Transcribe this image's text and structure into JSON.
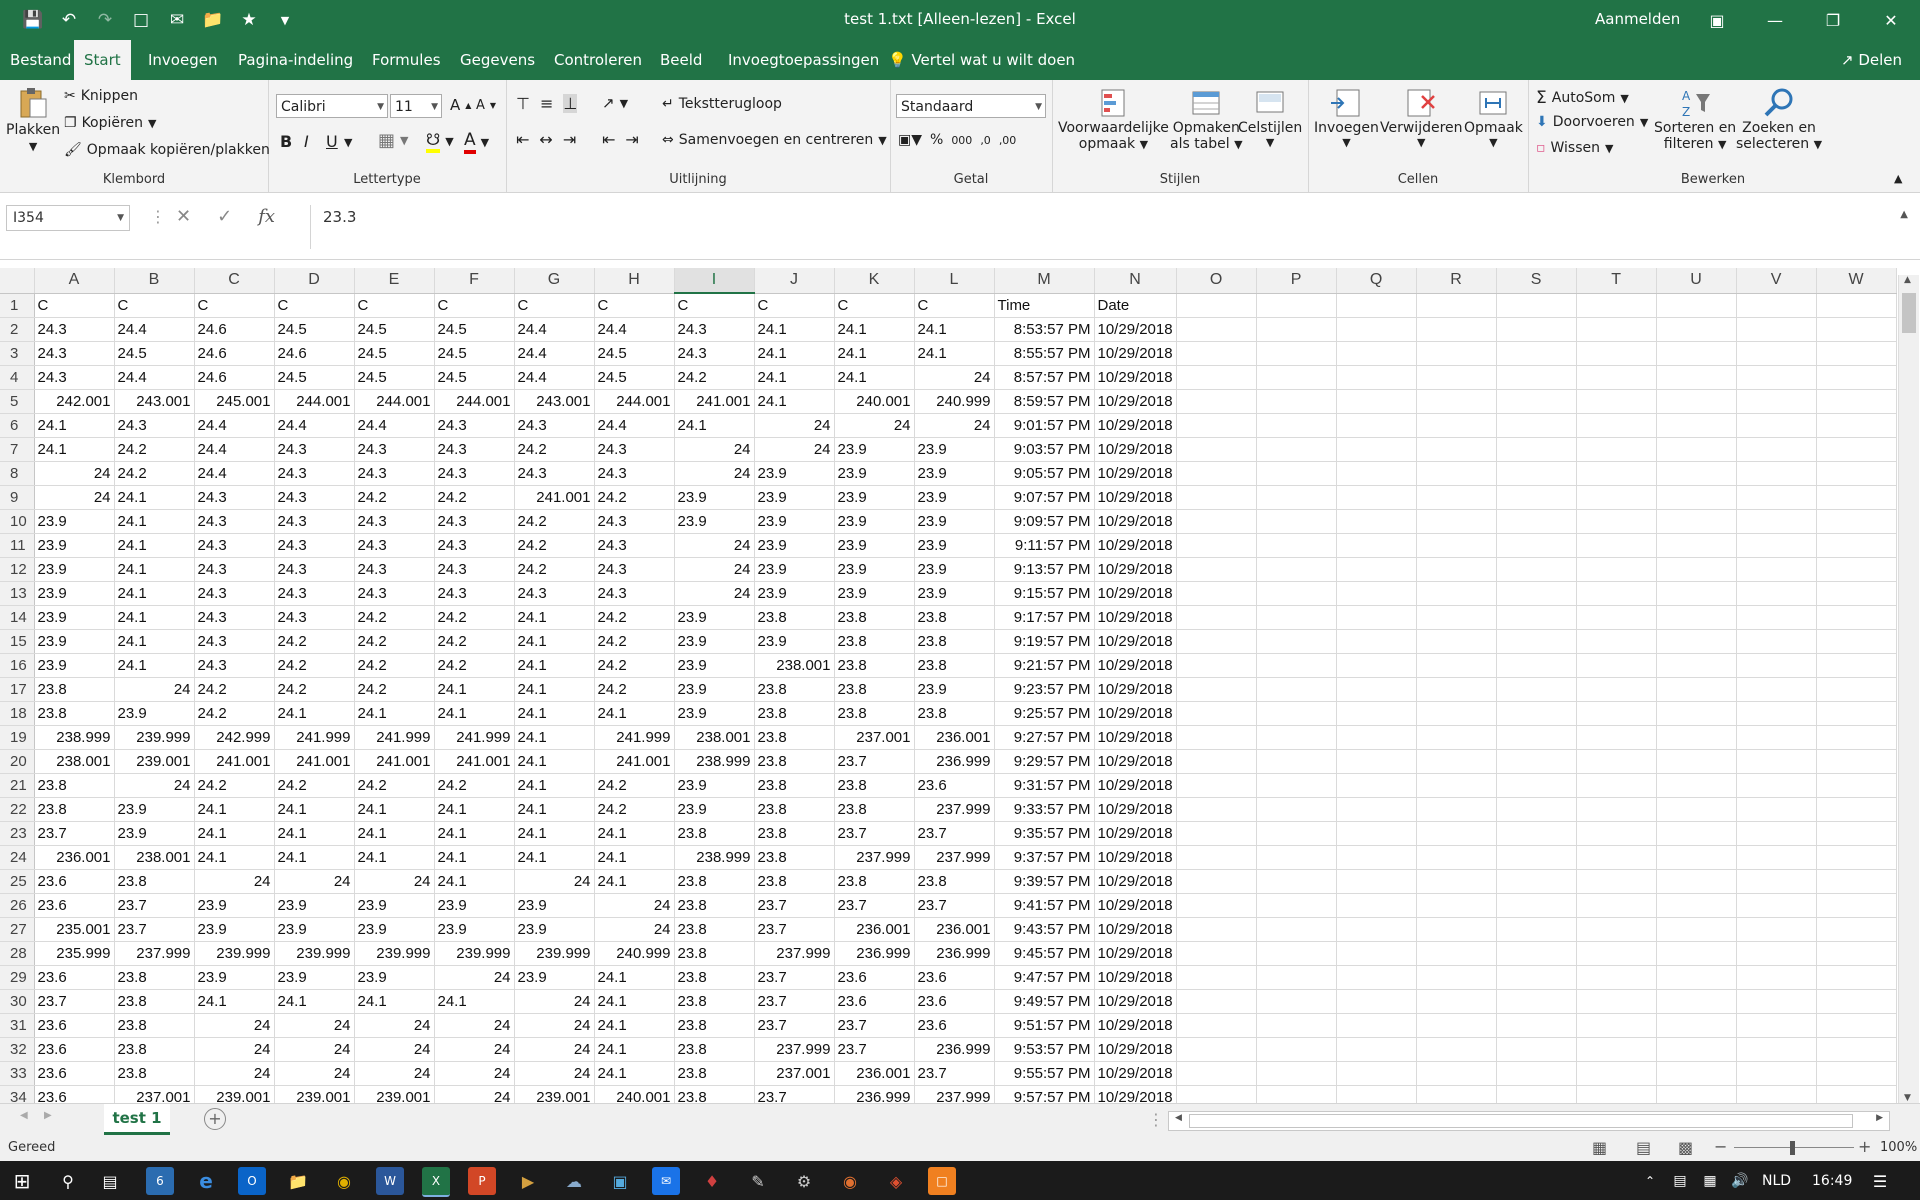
{
  "window": {
    "title": "test 1.txt  [Alleen-lezen]  -  Excel",
    "signin": "Aanmelden"
  },
  "tabs": [
    "Bestand",
    "Start",
    "Invoegen",
    "Pagina-indeling",
    "Formules",
    "Gegevens",
    "Controleren",
    "Beeld",
    "Invoegtoepassingen"
  ],
  "active_tab": "Start",
  "tellme": "Vertel wat u wilt doen",
  "share": "Delen",
  "ribbon": {
    "clipboard": {
      "paste": "Plakken",
      "cut": "Knippen",
      "copy": "Kopiëren",
      "format_painter": "Opmaak kopiëren/plakken",
      "label": "Klembord"
    },
    "font": {
      "name": "Calibri",
      "size": "11",
      "bold": "B",
      "italic": "I",
      "underline": "U",
      "label": "Lettertype"
    },
    "alignment": {
      "wrap": "Tekstterugloop",
      "merge": "Samenvoegen en centreren",
      "label": "Uitlijning"
    },
    "number": {
      "format": "Standaard",
      "label": "Getal"
    },
    "styles": {
      "conditional1": "Voorwaardelijke",
      "conditional2": "opmaak",
      "table1": "Opmaken",
      "table2": "als tabel",
      "cellstyles": "Celstijlen",
      "label": "Stijlen"
    },
    "cells": {
      "insert": "Invoegen",
      "delete": "Verwijderen",
      "format": "Opmaak",
      "label": "Cellen"
    },
    "editing": {
      "autosum": "AutoSom",
      "fill": "Doorvoeren",
      "clear": "Wissen",
      "sort1": "Sorteren en",
      "sort2": "filteren",
      "find1": "Zoeken en",
      "find2": "selecteren",
      "label": "Bewerken"
    }
  },
  "formula_bar": {
    "namebox": "I354",
    "value": "23.3"
  },
  "columns": [
    "A",
    "B",
    "C",
    "D",
    "E",
    "F",
    "G",
    "H",
    "I",
    "J",
    "K",
    "L",
    "M",
    "N",
    "O",
    "P",
    "Q",
    "R",
    "S",
    "T",
    "U",
    "V",
    "W"
  ],
  "selected_column": "I",
  "rows": [
    [
      "1",
      "C",
      "C",
      "C",
      "C",
      "C",
      "C",
      "C",
      "C",
      "C",
      "C",
      "C",
      "C",
      "Time",
      "Date"
    ],
    [
      "2",
      "24.3",
      "24.4",
      "24.6",
      "24.5",
      "24.5",
      "24.5",
      "24.4",
      "24.4",
      "24.3",
      "24.1",
      "24.1",
      "24.1",
      "8:53:57 PM",
      "10/29/2018"
    ],
    [
      "3",
      "24.3",
      "24.5",
      "24.6",
      "24.6",
      "24.5",
      "24.5",
      "24.4",
      "24.5",
      "24.3",
      "24.1",
      "24.1",
      "24.1",
      "8:55:57 PM",
      "10/29/2018"
    ],
    [
      "4",
      "24.3",
      "24.4",
      "24.6",
      "24.5",
      "24.5",
      "24.5",
      "24.4",
      "24.5",
      "24.2",
      "24.1",
      "24.1",
      "24",
      "8:57:57 PM",
      "10/29/2018"
    ],
    [
      "5",
      "242.001",
      "243.001",
      "245.001",
      "244.001",
      "244.001",
      "244.001",
      "243.001",
      "244.001",
      "241.001",
      "24.1",
      "240.001",
      "240.999",
      "8:59:57 PM",
      "10/29/2018"
    ],
    [
      "6",
      "24.1",
      "24.3",
      "24.4",
      "24.4",
      "24.4",
      "24.3",
      "24.3",
      "24.4",
      "24.1",
      "24",
      "24",
      "24",
      "9:01:57 PM",
      "10/29/2018"
    ],
    [
      "7",
      "24.1",
      "24.2",
      "24.4",
      "24.3",
      "24.3",
      "24.3",
      "24.2",
      "24.3",
      "24",
      "24",
      "23.9",
      "23.9",
      "9:03:57 PM",
      "10/29/2018"
    ],
    [
      "8",
      "24",
      "24.2",
      "24.4",
      "24.3",
      "24.3",
      "24.3",
      "24.3",
      "24.3",
      "24",
      "23.9",
      "23.9",
      "23.9",
      "9:05:57 PM",
      "10/29/2018"
    ],
    [
      "9",
      "24",
      "24.1",
      "24.3",
      "24.3",
      "24.2",
      "24.2",
      "241.001",
      "24.2",
      "23.9",
      "23.9",
      "23.9",
      "23.9",
      "9:07:57 PM",
      "10/29/2018"
    ],
    [
      "10",
      "23.9",
      "24.1",
      "24.3",
      "24.3",
      "24.3",
      "24.3",
      "24.2",
      "24.3",
      "23.9",
      "23.9",
      "23.9",
      "23.9",
      "9:09:57 PM",
      "10/29/2018"
    ],
    [
      "11",
      "23.9",
      "24.1",
      "24.3",
      "24.3",
      "24.3",
      "24.3",
      "24.2",
      "24.3",
      "24",
      "23.9",
      "23.9",
      "23.9",
      "9:11:57 PM",
      "10/29/2018"
    ],
    [
      "12",
      "23.9",
      "24.1",
      "24.3",
      "24.3",
      "24.3",
      "24.3",
      "24.2",
      "24.3",
      "24",
      "23.9",
      "23.9",
      "23.9",
      "9:13:57 PM",
      "10/29/2018"
    ],
    [
      "13",
      "23.9",
      "24.1",
      "24.3",
      "24.3",
      "24.3",
      "24.3",
      "24.3",
      "24.3",
      "24",
      "23.9",
      "23.9",
      "23.9",
      "9:15:57 PM",
      "10/29/2018"
    ],
    [
      "14",
      "23.9",
      "24.1",
      "24.3",
      "24.3",
      "24.2",
      "24.2",
      "24.1",
      "24.2",
      "23.9",
      "23.8",
      "23.8",
      "23.8",
      "9:17:57 PM",
      "10/29/2018"
    ],
    [
      "15",
      "23.9",
      "24.1",
      "24.3",
      "24.2",
      "24.2",
      "24.2",
      "24.1",
      "24.2",
      "23.9",
      "23.9",
      "23.8",
      "23.8",
      "9:19:57 PM",
      "10/29/2018"
    ],
    [
      "16",
      "23.9",
      "24.1",
      "24.3",
      "24.2",
      "24.2",
      "24.2",
      "24.1",
      "24.2",
      "23.9",
      "238.001",
      "23.8",
      "23.8",
      "9:21:57 PM",
      "10/29/2018"
    ],
    [
      "17",
      "23.8",
      "24",
      "24.2",
      "24.2",
      "24.2",
      "24.1",
      "24.1",
      "24.2",
      "23.9",
      "23.8",
      "23.8",
      "23.9",
      "9:23:57 PM",
      "10/29/2018"
    ],
    [
      "18",
      "23.8",
      "23.9",
      "24.2",
      "24.1",
      "24.1",
      "24.1",
      "24.1",
      "24.1",
      "23.9",
      "23.8",
      "23.8",
      "23.8",
      "9:25:57 PM",
      "10/29/2018"
    ],
    [
      "19",
      "238.999",
      "239.999",
      "242.999",
      "241.999",
      "241.999",
      "241.999",
      "24.1",
      "241.999",
      "238.001",
      "23.8",
      "237.001",
      "236.001",
      "9:27:57 PM",
      "10/29/2018"
    ],
    [
      "20",
      "238.001",
      "239.001",
      "241.001",
      "241.001",
      "241.001",
      "241.001",
      "24.1",
      "241.001",
      "238.999",
      "23.8",
      "23.7",
      "236.999",
      "9:29:57 PM",
      "10/29/2018"
    ],
    [
      "21",
      "23.8",
      "24",
      "24.2",
      "24.2",
      "24.2",
      "24.2",
      "24.1",
      "24.2",
      "23.9",
      "23.8",
      "23.8",
      "23.6",
      "9:31:57 PM",
      "10/29/2018"
    ],
    [
      "22",
      "23.8",
      "23.9",
      "24.1",
      "24.1",
      "24.1",
      "24.1",
      "24.1",
      "24.2",
      "23.9",
      "23.8",
      "23.8",
      "237.999",
      "9:33:57 PM",
      "10/29/2018"
    ],
    [
      "23",
      "23.7",
      "23.9",
      "24.1",
      "24.1",
      "24.1",
      "24.1",
      "24.1",
      "24.1",
      "23.8",
      "23.8",
      "23.7",
      "23.7",
      "9:35:57 PM",
      "10/29/2018"
    ],
    [
      "24",
      "236.001",
      "238.001",
      "24.1",
      "24.1",
      "24.1",
      "24.1",
      "24.1",
      "24.1",
      "238.999",
      "23.8",
      "237.999",
      "237.999",
      "9:37:57 PM",
      "10/29/2018"
    ],
    [
      "25",
      "23.6",
      "23.8",
      "24",
      "24",
      "24",
      "24.1",
      "24",
      "24.1",
      "23.8",
      "23.8",
      "23.8",
      "23.8",
      "9:39:57 PM",
      "10/29/2018"
    ],
    [
      "26",
      "23.6",
      "23.7",
      "23.9",
      "23.9",
      "23.9",
      "23.9",
      "23.9",
      "24",
      "23.8",
      "23.7",
      "23.7",
      "23.7",
      "9:41:57 PM",
      "10/29/2018"
    ],
    [
      "27",
      "235.001",
      "23.7",
      "23.9",
      "23.9",
      "23.9",
      "23.9",
      "23.9",
      "24",
      "23.8",
      "23.7",
      "236.001",
      "236.001",
      "9:43:57 PM",
      "10/29/2018"
    ],
    [
      "28",
      "235.999",
      "237.999",
      "239.999",
      "239.999",
      "239.999",
      "239.999",
      "239.999",
      "240.999",
      "23.8",
      "237.999",
      "236.999",
      "236.999",
      "9:45:57 PM",
      "10/29/2018"
    ],
    [
      "29",
      "23.6",
      "23.8",
      "23.9",
      "23.9",
      "23.9",
      "24",
      "23.9",
      "24.1",
      "23.8",
      "23.7",
      "23.6",
      "23.6",
      "9:47:57 PM",
      "10/29/2018"
    ],
    [
      "30",
      "23.7",
      "23.8",
      "24.1",
      "24.1",
      "24.1",
      "24.1",
      "24",
      "24.1",
      "23.8",
      "23.7",
      "23.6",
      "23.6",
      "9:49:57 PM",
      "10/29/2018"
    ],
    [
      "31",
      "23.6",
      "23.8",
      "24",
      "24",
      "24",
      "24",
      "24",
      "24.1",
      "23.8",
      "23.7",
      "23.7",
      "23.6",
      "9:51:57 PM",
      "10/29/2018"
    ],
    [
      "32",
      "23.6",
      "23.8",
      "24",
      "24",
      "24",
      "24",
      "24",
      "24.1",
      "23.8",
      "237.999",
      "23.7",
      "236.999",
      "9:53:57 PM",
      "10/29/2018"
    ],
    [
      "33",
      "23.6",
      "23.8",
      "24",
      "24",
      "24",
      "24",
      "24",
      "24.1",
      "23.8",
      "237.001",
      "236.001",
      "23.7",
      "9:55:57 PM",
      "10/29/2018"
    ],
    [
      "34",
      "23.6",
      "237.001",
      "239.001",
      "239.001",
      "239.001",
      "24",
      "239.001",
      "240.001",
      "23.8",
      "23.7",
      "236.999",
      "237.999",
      "9:57:57 PM",
      "10/29/2018"
    ]
  ],
  "sheet_tab": "test 1",
  "status": {
    "ready": "Gereed",
    "zoom": "100%"
  },
  "taskbar": {
    "lang": "NLD",
    "time": "16:49",
    "calendar_day": "6"
  }
}
